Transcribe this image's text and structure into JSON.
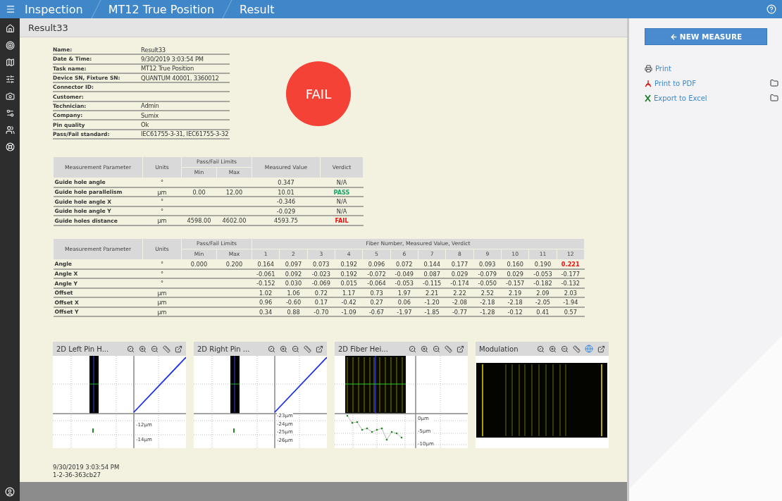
{
  "top_bar": {
    "breadcrumbs": [
      "Inspection",
      "MT12 True Position",
      "Result"
    ]
  },
  "page_title": "Result33",
  "info": [
    {
      "label": "Name:",
      "value": "Result33"
    },
    {
      "label": "Date & Time:",
      "value": "9/30/2019 3:03:54 PM"
    },
    {
      "label": "Task name:",
      "value": "MT12 True Position"
    },
    {
      "label": "Device SN, Fixture SN:",
      "value": "QUANTUM 40001, 3360012"
    },
    {
      "label": "Connector ID:"
    },
    {
      "label": "Customer:"
    },
    {
      "label": "Technician:",
      "value": "Admin"
    },
    {
      "label": "Company:",
      "value": "Sumix"
    },
    {
      "label": "Pin quality",
      "value": "Ok"
    },
    {
      "label": "Pass/Fail standard:",
      "value": "IEC61755-3-31, IEC61755-3-32"
    }
  ],
  "result": {
    "text": "FAIL",
    "kind": "fail"
  },
  "summary_table": {
    "headers": {
      "parameter": "Measurement Parameter",
      "units": "Units",
      "limits": "Pass/Fail Limits",
      "min": "Min",
      "max": "Max",
      "measured": "Measured Value",
      "verdict": "Verdict"
    },
    "rows": [
      {
        "parameter": "Guide hole angle",
        "units": "°",
        "measured": "0.347",
        "verdict": "N/A",
        "kind": "na"
      },
      {
        "parameter": "Guide hole parallelism",
        "units": "µm",
        "min": "0.00",
        "max": "12.00",
        "measured": "10.01",
        "verdict": "PASS",
        "kind": "pass"
      },
      {
        "parameter": "Guide hole angle X",
        "units": "°",
        "measured": "-0.346",
        "verdict": "N/A",
        "kind": "na"
      },
      {
        "parameter": "Guide hole angle Y",
        "units": "°",
        "measured": "-0.029",
        "verdict": "N/A",
        "kind": "na"
      },
      {
        "parameter": "Guide holes distance",
        "units": "µm",
        "min": "4598.00",
        "max": "4602.00",
        "measured": "4593.75",
        "verdict": "FAIL",
        "kind": "fail"
      }
    ]
  },
  "fiber_table": {
    "headers": {
      "parameter": "Measurement Parameter",
      "units": "Units",
      "limits": "Pass/Fail Limits",
      "min": "Min",
      "max": "Max",
      "fibers": "Fiber Number, Measured Value, Verdict"
    },
    "fiber_numbers": [
      "1",
      "2",
      "3",
      "4",
      "5",
      "6",
      "7",
      "8",
      "9",
      "10",
      "11",
      "12"
    ],
    "rows": [
      {
        "parameter": "Angle",
        "units": "°",
        "min": "0.000",
        "max": "0.200",
        "cells": [
          {
            "value": "0.164",
            "fail": false
          },
          {
            "value": "0.097",
            "fail": false
          },
          {
            "value": "0.073",
            "fail": false
          },
          {
            "value": "0.192",
            "fail": false
          },
          {
            "value": "0.096",
            "fail": false
          },
          {
            "value": "0.072",
            "fail": false
          },
          {
            "value": "0.144",
            "fail": false
          },
          {
            "value": "0.177",
            "fail": false
          },
          {
            "value": "0.093",
            "fail": false
          },
          {
            "value": "0.160",
            "fail": false
          },
          {
            "value": "0.190",
            "fail": false
          },
          {
            "value": "0.221",
            "fail": true
          }
        ]
      },
      {
        "parameter": "Angle X",
        "units": "°",
        "cells": [
          {
            "value": "-0.061",
            "fail": false
          },
          {
            "value": "0.092",
            "fail": false
          },
          {
            "value": "-0.023",
            "fail": false
          },
          {
            "value": "0.192",
            "fail": false
          },
          {
            "value": "-0.072",
            "fail": false
          },
          {
            "value": "-0.049",
            "fail": false
          },
          {
            "value": "0.087",
            "fail": false
          },
          {
            "value": "0.029",
            "fail": false
          },
          {
            "value": "-0.079",
            "fail": false
          },
          {
            "value": "0.029",
            "fail": false
          },
          {
            "value": "-0.053",
            "fail": false
          },
          {
            "value": "-0.177",
            "fail": false
          }
        ]
      },
      {
        "parameter": "Angle Y",
        "units": "°",
        "cells": [
          {
            "value": "-0.152",
            "fail": false
          },
          {
            "value": "0.030",
            "fail": false
          },
          {
            "value": "-0.069",
            "fail": false
          },
          {
            "value": "0.015",
            "fail": false
          },
          {
            "value": "-0.064",
            "fail": false
          },
          {
            "value": "-0.053",
            "fail": false
          },
          {
            "value": "-0.115",
            "fail": false
          },
          {
            "value": "-0.174",
            "fail": false
          },
          {
            "value": "-0.050",
            "fail": false
          },
          {
            "value": "-0.157",
            "fail": false
          },
          {
            "value": "-0.182",
            "fail": false
          },
          {
            "value": "-0.132",
            "fail": false
          }
        ]
      },
      {
        "parameter": "Offset",
        "units": "µm",
        "cells": [
          {
            "value": "1.02",
            "fail": false
          },
          {
            "value": "1.06",
            "fail": false
          },
          {
            "value": "0.72",
            "fail": false
          },
          {
            "value": "1.17",
            "fail": false
          },
          {
            "value": "0.73",
            "fail": false
          },
          {
            "value": "1.97",
            "fail": false
          },
          {
            "value": "2.21",
            "fail": false
          },
          {
            "value": "2.22",
            "fail": false
          },
          {
            "value": "2.52",
            "fail": false
          },
          {
            "value": "2.19",
            "fail": false
          },
          {
            "value": "2.09",
            "fail": false
          },
          {
            "value": "2.03",
            "fail": false
          }
        ]
      },
      {
        "parameter": "Offset X",
        "units": "µm",
        "cells": [
          {
            "value": "0.96",
            "fail": false
          },
          {
            "value": "-0.60",
            "fail": false
          },
          {
            "value": "0.17",
            "fail": false
          },
          {
            "value": "-0.42",
            "fail": false
          },
          {
            "value": "0.27",
            "fail": false
          },
          {
            "value": "0.06",
            "fail": false
          },
          {
            "value": "-1.20",
            "fail": false
          },
          {
            "value": "-2.08",
            "fail": false
          },
          {
            "value": "-2.18",
            "fail": false
          },
          {
            "value": "-2.18",
            "fail": false
          },
          {
            "value": "-2.05",
            "fail": false
          },
          {
            "value": "-1.94",
            "fail": false
          }
        ]
      },
      {
        "parameter": "Offset Y",
        "units": "µm",
        "cells": [
          {
            "value": "0.34",
            "fail": false
          },
          {
            "value": "0.88",
            "fail": false
          },
          {
            "value": "-0.70",
            "fail": false
          },
          {
            "value": "-1.09",
            "fail": false
          },
          {
            "value": "-0.67",
            "fail": false
          },
          {
            "value": "-1.97",
            "fail": false
          },
          {
            "value": "-1.85",
            "fail": false
          },
          {
            "value": "-0.77",
            "fail": false
          },
          {
            "value": "-1.28",
            "fail": false
          },
          {
            "value": "-0.12",
            "fail": false
          },
          {
            "value": "0.41",
            "fail": false
          },
          {
            "value": "0.57",
            "fail": false
          }
        ]
      }
    ]
  },
  "charts": [
    {
      "title": "2D Left Pin H...",
      "kind": "pin",
      "axis_labels": [
        "-12µm",
        "-14µm"
      ]
    },
    {
      "title": "2D Right Pin ...",
      "kind": "pin",
      "axis_labels": [
        "-23µm",
        "-24µm",
        "-25µm",
        "-26µm"
      ]
    },
    {
      "title": "2D Fiber Hei...",
      "kind": "fiber",
      "axis_labels": [
        "0µm",
        "-5µm",
        "-10µm"
      ]
    },
    {
      "title": "Modulation",
      "kind": "modulation"
    }
  ],
  "footer": [
    "9/30/2019 3:03:54 PM",
    "1-2-36-363cb27"
  ],
  "actions": {
    "button": "NEW MEASURE",
    "links": [
      {
        "label": "Print",
        "kind": "print",
        "folder": false
      },
      {
        "label": "Print to PDF",
        "kind": "pdf",
        "folder": true
      },
      {
        "label": "Export to Excel",
        "kind": "excel",
        "folder": true
      }
    ]
  }
}
